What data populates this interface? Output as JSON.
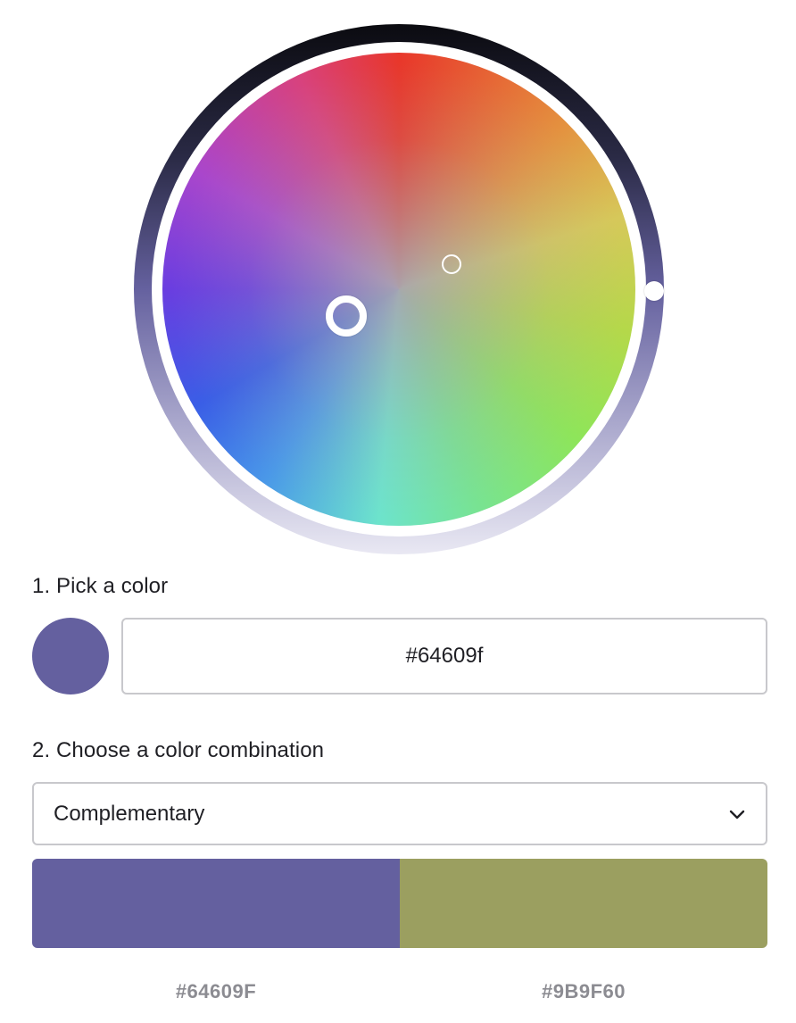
{
  "picker": {
    "step1_label": "1. Pick a color",
    "hex_value": "#64609f",
    "swatch_color": "#64609f",
    "ring_gradient": [
      "#0b0b10",
      "#2a2a45",
      "#65619f",
      "#a9a7cc",
      "#e9e8f3"
    ]
  },
  "combination": {
    "step2_label": "2. Choose a color combination",
    "selected": "Complementary"
  },
  "results": [
    {
      "hex": "#64609F",
      "color": "#64609f"
    },
    {
      "hex": "#9B9F60",
      "color": "#9b9f60"
    }
  ],
  "icons": {
    "dropdown": "chevron-down-icon"
  }
}
